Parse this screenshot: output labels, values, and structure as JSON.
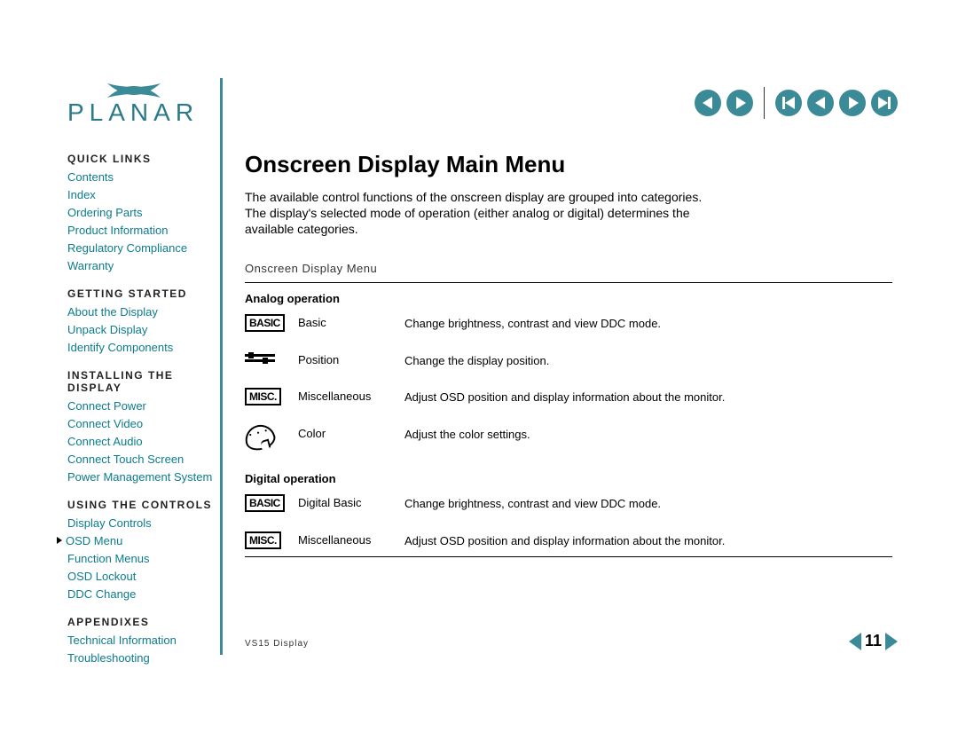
{
  "brand": "PLANAR",
  "sidebar": {
    "sections": [
      {
        "heading": "QUICK LINKS",
        "items": [
          "Contents",
          "Index",
          "Ordering Parts",
          "Product Information",
          "Regulatory Compliance",
          "Warranty"
        ]
      },
      {
        "heading": "GETTING STARTED",
        "items": [
          "About the Display",
          "Unpack Display",
          "Identify Components"
        ]
      },
      {
        "heading": "INSTALLING THE DISPLAY",
        "items": [
          "Connect Power",
          "Connect Video",
          "Connect Audio",
          "Connect Touch Screen",
          "Power Management System"
        ]
      },
      {
        "heading": "USING THE CONTROLS",
        "items": [
          "Display Controls",
          "OSD Menu",
          "Function Menus",
          "OSD Lockout",
          "DDC Change"
        ],
        "current": 1
      },
      {
        "heading": "APPENDIXES",
        "items": [
          "Technical Information",
          "Troubleshooting"
        ]
      }
    ]
  },
  "main": {
    "title": "Onscreen Display Main Menu",
    "intro": "The available control functions of the onscreen display are grouped into categories. The display's selected mode of operation (either analog or digital) determines the available categories.",
    "table_caption": "Onscreen Display Menu",
    "analog_heading": "Analog operation",
    "digital_heading": "Digital operation",
    "analog": [
      {
        "icon": "BASIC",
        "name": "Basic",
        "desc": "Change brightness, contrast and view DDC mode."
      },
      {
        "icon": "sliders",
        "name": "Position",
        "desc": "Change the display position."
      },
      {
        "icon": "MISC.",
        "name": "Miscellaneous",
        "desc": "Adjust OSD position and display information about the monitor."
      },
      {
        "icon": "palette",
        "name": "Color",
        "desc": "Adjust the color settings."
      }
    ],
    "digital": [
      {
        "icon": "BASIC",
        "name": "Digital Basic",
        "desc": "Change brightness, contrast and view DDC mode."
      },
      {
        "icon": "MISC.",
        "name": "Miscellaneous",
        "desc": "Adjust OSD position and display information about the monitor."
      }
    ]
  },
  "footer": {
    "product": "VS15 Display",
    "page": "11"
  },
  "nav_icons": {
    "prev": "prev",
    "next": "next",
    "first": "first",
    "back": "back",
    "forward": "forward",
    "last": "last"
  }
}
